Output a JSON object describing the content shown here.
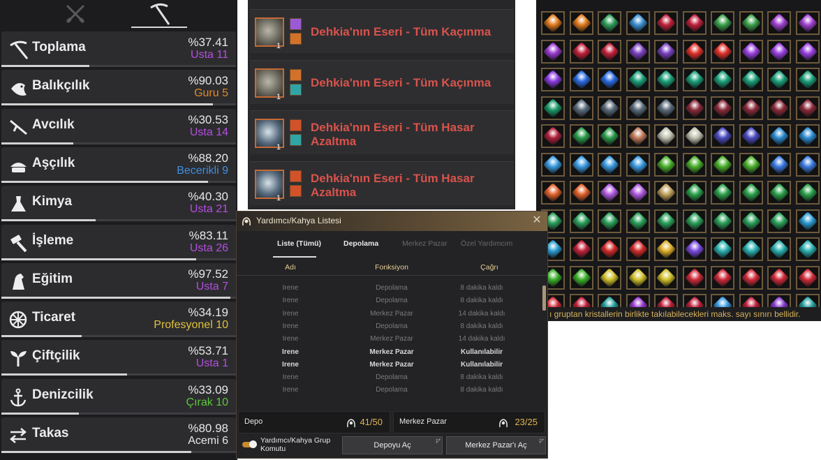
{
  "skills": {
    "tabs": [
      {
        "icon": "crossed-swords-icon",
        "active": false
      },
      {
        "icon": "pickaxe-icon",
        "active": true
      }
    ],
    "items": [
      {
        "name": "Toplama",
        "icon": "pickaxe-icon",
        "percent": "%37.41",
        "rank": "Usta 11",
        "rank_color": "#b54fe0",
        "progress": 0.3741
      },
      {
        "name": "Balıkçılık",
        "icon": "fish-icon",
        "percent": "%90.03",
        "rank": "Guru 5",
        "rank_color": "#e08a2a",
        "progress": 0.9003
      },
      {
        "name": "Avcılık",
        "icon": "rifle-icon",
        "percent": "%30.53",
        "rank": "Usta 14",
        "rank_color": "#b54fe0",
        "progress": 0.3053
      },
      {
        "name": "Aşçılık",
        "icon": "cooking-pot-icon",
        "percent": "%88.20",
        "rank": "Becerikli 9",
        "rank_color": "#3f8fe0",
        "progress": 0.882
      },
      {
        "name": "Kimya",
        "icon": "flask-icon",
        "percent": "%40.30",
        "rank": "Usta 21",
        "rank_color": "#b54fe0",
        "progress": 0.403
      },
      {
        "name": "İşleme",
        "icon": "hammer-icon",
        "percent": "%83.11",
        "rank": "Usta 26",
        "rank_color": "#b54fe0",
        "progress": 0.8311
      },
      {
        "name": "Eğitim",
        "icon": "horse-icon",
        "percent": "%97.52",
        "rank": "Usta 7",
        "rank_color": "#b54fe0",
        "progress": 0.9752
      },
      {
        "name": "Ticaret",
        "icon": "wheel-icon",
        "percent": "%34.19",
        "rank": "Profesyonel 10",
        "rank_color": "#e0c23a",
        "progress": 0.3419
      },
      {
        "name": "Çiftçilik",
        "icon": "sprout-icon",
        "percent": "%53.71",
        "rank": "Usta 1",
        "rank_color": "#b54fe0",
        "progress": 0.5371
      },
      {
        "name": "Denizcilik",
        "icon": "anchor-icon",
        "percent": "%33.09",
        "rank": "Çırak 10",
        "rank_color": "#5cc93a",
        "progress": 0.3309
      },
      {
        "name": "Takas",
        "icon": "exchange-icon",
        "percent": "%80.98",
        "rank": "Acemi 6",
        "rank_color": "#e8e8e8",
        "progress": 0.8098
      }
    ]
  },
  "buffs": {
    "items": [
      {
        "title": "Dehkia'nın Eseri - Tüm Kaçınma",
        "qty": "1",
        "icon": "relic-stone-icon",
        "subicons": [
          "#9a5ad8",
          "#d2722a"
        ]
      },
      {
        "title": "Dehkia'nın Eseri - Tüm Kaçınma",
        "qty": "1",
        "icon": "relic-stone-icon",
        "subicons": [
          "#d2722a",
          "#2fa5a8"
        ]
      },
      {
        "title": "Dehkia'nın Eseri - Tüm Hasar Azaltma",
        "qty": "1",
        "icon": "relic-orb-icon",
        "subicons": [
          "#d2522a",
          "#2fa5a8"
        ]
      },
      {
        "title": "Dehkia'nın Eseri - Tüm Hasar Azaltma",
        "qty": "1",
        "icon": "relic-orb-icon",
        "subicons": [
          "#d2522a",
          "#d2522a"
        ]
      }
    ]
  },
  "crystals": {
    "rows": [
      [
        "#e07a1a",
        "#e07a1a",
        "#2f9d5a",
        "#3a8fd0",
        "#c0203a",
        "#c0203a",
        "#3aa04a",
        "#3aa04a",
        "#a040d0",
        "#a040d0"
      ],
      [
        "#9a3ad0",
        "#c0203a",
        "#c0203a",
        "#7a40c0",
        "#7a40c0",
        "#e0302a",
        "#e0302a",
        "#9a40e0",
        "#9a40e0",
        "#9a40e0"
      ],
      [
        "#8a3ae0",
        "#2a6ae0",
        "#2a6ae0",
        "#1aa07a",
        "#1aa07a",
        "#1aa07a",
        "#1aa07a",
        "#1aa07a",
        "#1aa07a",
        "#1aa07a"
      ],
      [
        "#1a9a6a",
        "#5a6a7a",
        "#5a6a7a",
        "#5a6a7a",
        "#5a6a7a",
        "#8a2a3a",
        "#8a2a3a",
        "#8a2a3a",
        "#8a2a3a",
        "#8a2a3a"
      ],
      [
        "#b0203a",
        "#2a9a4a",
        "#2a9a4a",
        "#c07a5a",
        "#c0c0b0",
        "#c0c0b0",
        "#4a4ac0",
        "#4a4ac0",
        "#2a8ad0",
        "#2a8ad0"
      ],
      [
        "#3a9ae0",
        "#3a9ae0",
        "#3a9ae0",
        "#3a9ae0",
        "#4ab02a",
        "#4ab02a",
        "#4ab02a",
        "#4ab02a",
        "#3a7ae0",
        "#3a7ae0"
      ],
      [
        "#e0602a",
        "#e0602a",
        "#b05ae0",
        "#b05ae0",
        "#c0a05a",
        "#2aa04a",
        "#2aa04a",
        "#2aa04a",
        "#2aa04a",
        "#2aa04a"
      ],
      [
        "#2aa05a",
        "#2aa05a",
        "#2aa05a",
        "#2aa05a",
        "#2aa05a",
        "#2aa05a",
        "#2aa05a",
        "#2aa05a",
        "#2aa05a",
        "#2a9ad0"
      ],
      [
        "#2a9ad0",
        "#c0203a",
        "#d02a2a",
        "#d02a2a",
        "#e0b02a",
        "#7a4ae0",
        "#2ab0b0",
        "#2ab0b0",
        "#2ab0b0",
        "#2ab0b0"
      ],
      [
        "#3ab02a",
        "#3ab02a",
        "#d0c02a",
        "#d0c02a",
        "#d0c02a",
        "#d02a3a",
        "#d02a3a",
        "#d02a3a",
        "#d02a3a",
        "#d02a3a"
      ],
      [
        "#d02a3a",
        "#c0203a",
        "#2aa0a0",
        "#9a3ad0",
        "#c0203a",
        "#c0203a",
        "#3a9ae0",
        "#c0203a",
        "#8a3ad0",
        "#2aa0a0"
      ]
    ],
    "note": "ı gruptan kristallerin birlikte takılabilecekleri maks. sayı sınırı bellidir."
  },
  "helper": {
    "title": "Yardımcı/Kahya Listesi",
    "close": "✕",
    "tabs": [
      {
        "label": "Liste (Tümü)",
        "active": true
      },
      {
        "label": "Depolama",
        "active": true
      },
      {
        "label": "Merkez Pazar",
        "active": false
      },
      {
        "label": "Özel Yardımcım",
        "active": false
      }
    ],
    "columns": {
      "name": "Adı",
      "function": "Fonksiyon",
      "call": "Çağrı"
    },
    "rows": [
      {
        "name": "Irene",
        "function": "Depolama",
        "call": "8 dakika kaldı",
        "active": false
      },
      {
        "name": "Irene",
        "function": "Depolama",
        "call": "8 dakika kaldı",
        "active": false
      },
      {
        "name": "Irene",
        "function": "Merkez Pazar",
        "call": "14 dakika kaldı",
        "active": false
      },
      {
        "name": "Irene",
        "function": "Depolama",
        "call": "8 dakika kaldı",
        "active": false
      },
      {
        "name": "Irene",
        "function": "Merkez Pazar",
        "call": "14 dakika kaldı",
        "active": false
      },
      {
        "name": "Irene",
        "function": "Merkez Pazar",
        "call": "Kullanılabilir",
        "active": true
      },
      {
        "name": "Irene",
        "function": "Merkez Pazar",
        "call": "Kullanılabilir",
        "active": true
      },
      {
        "name": "Irene",
        "function": "Depolama",
        "call": "8 dakika kaldı",
        "active": false
      },
      {
        "name": "Irene",
        "function": "Depolama",
        "call": "8 dakika kaldı",
        "active": false
      }
    ],
    "depot": {
      "label": "Depo",
      "value": "41/50"
    },
    "market": {
      "label": "Merkez Pazar",
      "value": "23/25"
    },
    "group_toggle": {
      "label": "Yardımcı/Kahya Grup Komutu",
      "on": true
    },
    "buttons": {
      "open_depot": "Depoyu Aç",
      "open_market": "Merkez Pazar'ı Aç"
    }
  }
}
